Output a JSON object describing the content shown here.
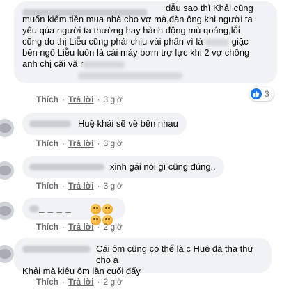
{
  "comments": [
    {
      "text_lines": [
        "dẫu sao thì Khải cũng",
        "muốn kiếm tiền mua nhà cho vợ mà,đàn ông khi người ta",
        "yêu qúa người ta thường hay hành động mù qoáng,lỗi",
        "cũng do thị Liễu cũng phải chịu vài phần vì là",
        "giặc",
        "bên ngô Liễu luôn là cái máy bơm trợ lực khi 2 vợ chồng",
        "anh chị cãi vã r"
      ],
      "like_label": "Thích",
      "reply_label": "Trả lời",
      "time": "3 giờ",
      "reaction_count": "3"
    },
    {
      "text": "Huệ khải sẽ về bên nhau",
      "like_label": "Thích",
      "reply_label": "Trả lời",
      "time": "3 giờ"
    },
    {
      "text": "xinh gái nói gì cũng đúng..",
      "like_label": "Thích",
      "reply_label": "Trả lời",
      "time": "3 giờ"
    },
    {
      "text": "_ _ _ _",
      "emojis": [
        "clapping-hands-emoji",
        "clapping-hands-emoji",
        "clapping-hands-emoji",
        "clapping-hands-emoji"
      ],
      "like_label": "Thích",
      "reply_label": "Trả lời",
      "time": "2 giờ"
    },
    {
      "text_lines": [
        "Cái ôm cũng có thể là c Huệ đã tha thứ cho a",
        "Khải mà kiêu ôm lần cuối đấy"
      ],
      "like_label": "Thích",
      "reply_label": "Trả lời",
      "time": "2 giờ"
    }
  ],
  "colors": {
    "bubble_bg": "#f0f2f5",
    "action_text": "#65676b",
    "like_blue": "#1877f2"
  }
}
